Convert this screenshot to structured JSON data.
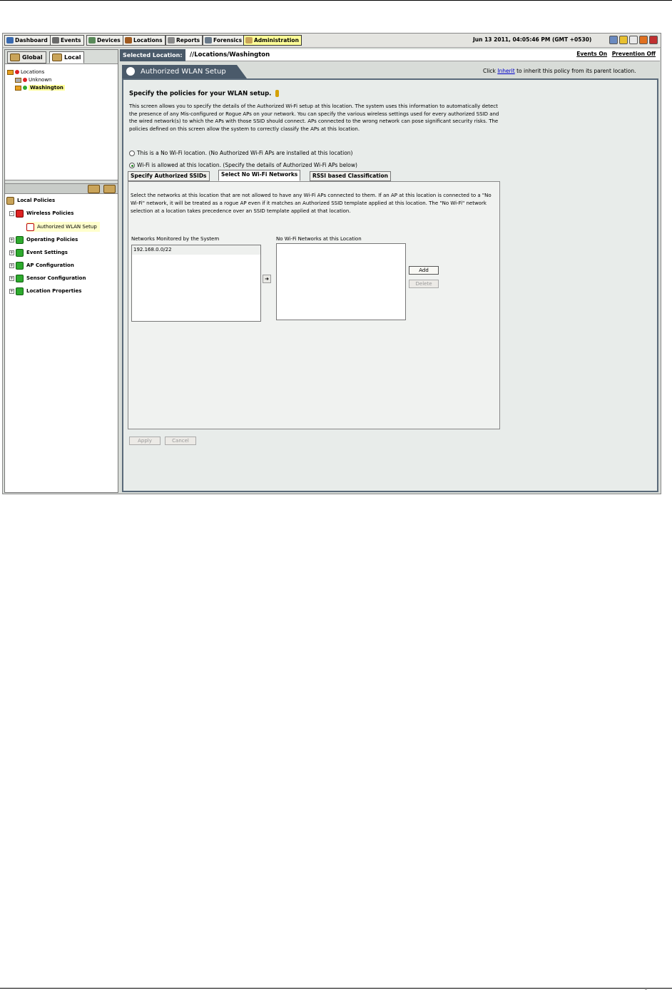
{
  "nav": {
    "buttons": [
      {
        "label": "Dashboard",
        "color": "#3a6ab0"
      },
      {
        "label": "Events",
        "color": "#6a6a6a"
      },
      {
        "label": "Devices",
        "color": "#5a8a5a"
      },
      {
        "label": "Locations",
        "color": "#a05a20"
      },
      {
        "label": "Reports",
        "color": "#8a8a8a"
      },
      {
        "label": "Forensics",
        "color": "#6a7a8a"
      },
      {
        "label": "Administration",
        "color": "#c9a45a"
      }
    ],
    "active": "Administration",
    "datetime": "Jun 13 2011, 04:05:46 PM (GMT +0530)",
    "icons": [
      "refresh-icon",
      "help-icon",
      "list-icon",
      "shield-icon",
      "logout-icon"
    ]
  },
  "scope_tabs": {
    "global": "Global",
    "local": "Local"
  },
  "locations": {
    "root": "Locations",
    "items": [
      {
        "label": "Unknown",
        "status_color": "#d22"
      },
      {
        "label": "Washington",
        "status_color": "#2eaa2e"
      }
    ]
  },
  "policies": {
    "root": "Local Policies",
    "wireless": "Wireless Policies",
    "selected_item": "Authorized WLAN Setup",
    "groups": [
      "Operating Policies",
      "Event Settings",
      "AP Configuration",
      "Sensor Configuration",
      "Location Properties"
    ]
  },
  "location_bar": {
    "label": "Selected Location:",
    "path": "//Locations/Washington",
    "events": "Events On",
    "prevention": "Prevention Off"
  },
  "page": {
    "title": "Authorized WLAN Setup",
    "inherit_prefix": "Click",
    "inherit_link": "Inherit",
    "inherit_suffix": "to inherit this policy from its parent location.",
    "heading": "Specify the policies for your WLAN setup.",
    "description": "This screen allows you to specify the details of the Authorized Wi-Fi setup at this location. The system uses this information to automatically detect the presence of any Mis-configured or Rogue APs on your network. You can specify the various wireless settings used for every authorized SSID and the wired network(s) to which the APs with those SSID should connect. APs connected to the wrong network can pose significant security risks. The policies defined on this screen allow the system to correctly classify the APs at this location.",
    "radio_no_wifi": "This is a No Wi-Fi location. (No Authorized Wi-Fi APs are installed at this location)",
    "radio_wifi": "Wi-Fi is allowed at this location. (Specify the details of Authorized Wi-Fi APs below)",
    "selected_radio": "wifi"
  },
  "tabs": [
    "Specify Authorized SSIDs",
    "Select No Wi-Fi Networks",
    "RSSI based Classification"
  ],
  "active_tab": "Select No Wi-Fi Networks",
  "panel": {
    "description": "Select the networks at this location that are not allowed to have any Wi-Fi APs connected to them. If an AP at this location is connected to a \"No Wi-Fi\" network, it will be treated as a rogue AP even if it matches an Authorized SSID template applied at this location. The \"No Wi-Fi\" network selection at a location takes precedence over an SSID template applied at that location.",
    "monitored_label": "Networks Monitored by the System",
    "nowifi_label": "No Wi-Fi Networks at this Location",
    "monitored_items": [
      "192.168.0.0/22"
    ],
    "nowifi_items": [],
    "add": "Add",
    "delete": "Delete"
  },
  "footer": {
    "apply": "Apply",
    "cancel": "Cancel"
  },
  "page_number": "_"
}
